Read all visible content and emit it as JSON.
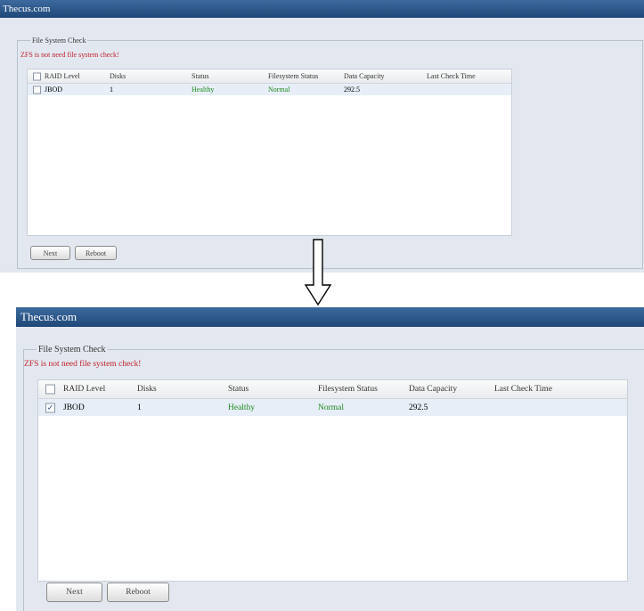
{
  "window": {
    "title": "Thecus.com"
  },
  "section": {
    "legend": "File System Check",
    "warning": "ZFS is not need file system check!"
  },
  "grid": {
    "columns": [
      "RAID Level",
      "Disks",
      "Status",
      "Filesystem Status",
      "Data Capacity",
      "Last Check Time"
    ],
    "rows": [
      {
        "raid_level": "JBOD",
        "disks": "1",
        "status": "Healthy",
        "fs_status": "Normal",
        "data_capacity": "292.5",
        "last_check": ""
      }
    ]
  },
  "panels": [
    {
      "row_checked": false
    },
    {
      "row_checked": true
    }
  ],
  "buttons": {
    "next": "Next",
    "reboot": "Reboot"
  },
  "icons": {
    "arrow": "down-arrow-icon",
    "checkbox": "checkbox-icon"
  },
  "colors": {
    "titlebar": "#2a5587",
    "warning": "#c0202a",
    "healthy": "#1e8a1e",
    "panel_bg": "#e3e8f0",
    "selected_row": "#e7eef7"
  }
}
